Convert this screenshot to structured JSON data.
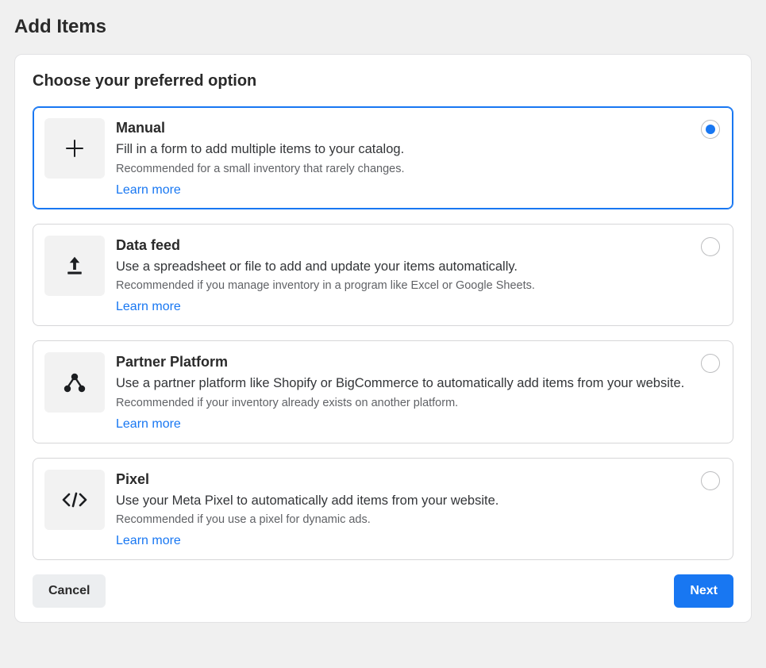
{
  "header": {
    "title": "Add Items"
  },
  "panel": {
    "heading": "Choose your preferred option"
  },
  "options": [
    {
      "id": "manual",
      "title": "Manual",
      "description": "Fill in a form to add multiple items to your catalog.",
      "recommendation": "Recommended for a small inventory that rarely changes.",
      "link_label": "Learn more",
      "selected": true,
      "icon": "plus-icon"
    },
    {
      "id": "datafeed",
      "title": "Data feed",
      "description": "Use a spreadsheet or file to add and update your items automatically.",
      "recommendation": "Recommended if you manage inventory in a program like Excel or Google Sheets.",
      "link_label": "Learn more",
      "selected": false,
      "icon": "upload-icon"
    },
    {
      "id": "partner",
      "title": "Partner Platform",
      "description": "Use a partner platform like Shopify or BigCommerce to automatically add items from your website.",
      "recommendation": "Recommended if your inventory already exists on another platform.",
      "link_label": "Learn more",
      "selected": false,
      "icon": "network-icon"
    },
    {
      "id": "pixel",
      "title": "Pixel",
      "description": "Use your Meta Pixel to automatically add items from your website.",
      "recommendation": "Recommended if you use a pixel for dynamic ads.",
      "link_label": "Learn more",
      "selected": false,
      "icon": "code-icon"
    }
  ],
  "footer": {
    "cancel_label": "Cancel",
    "next_label": "Next"
  }
}
